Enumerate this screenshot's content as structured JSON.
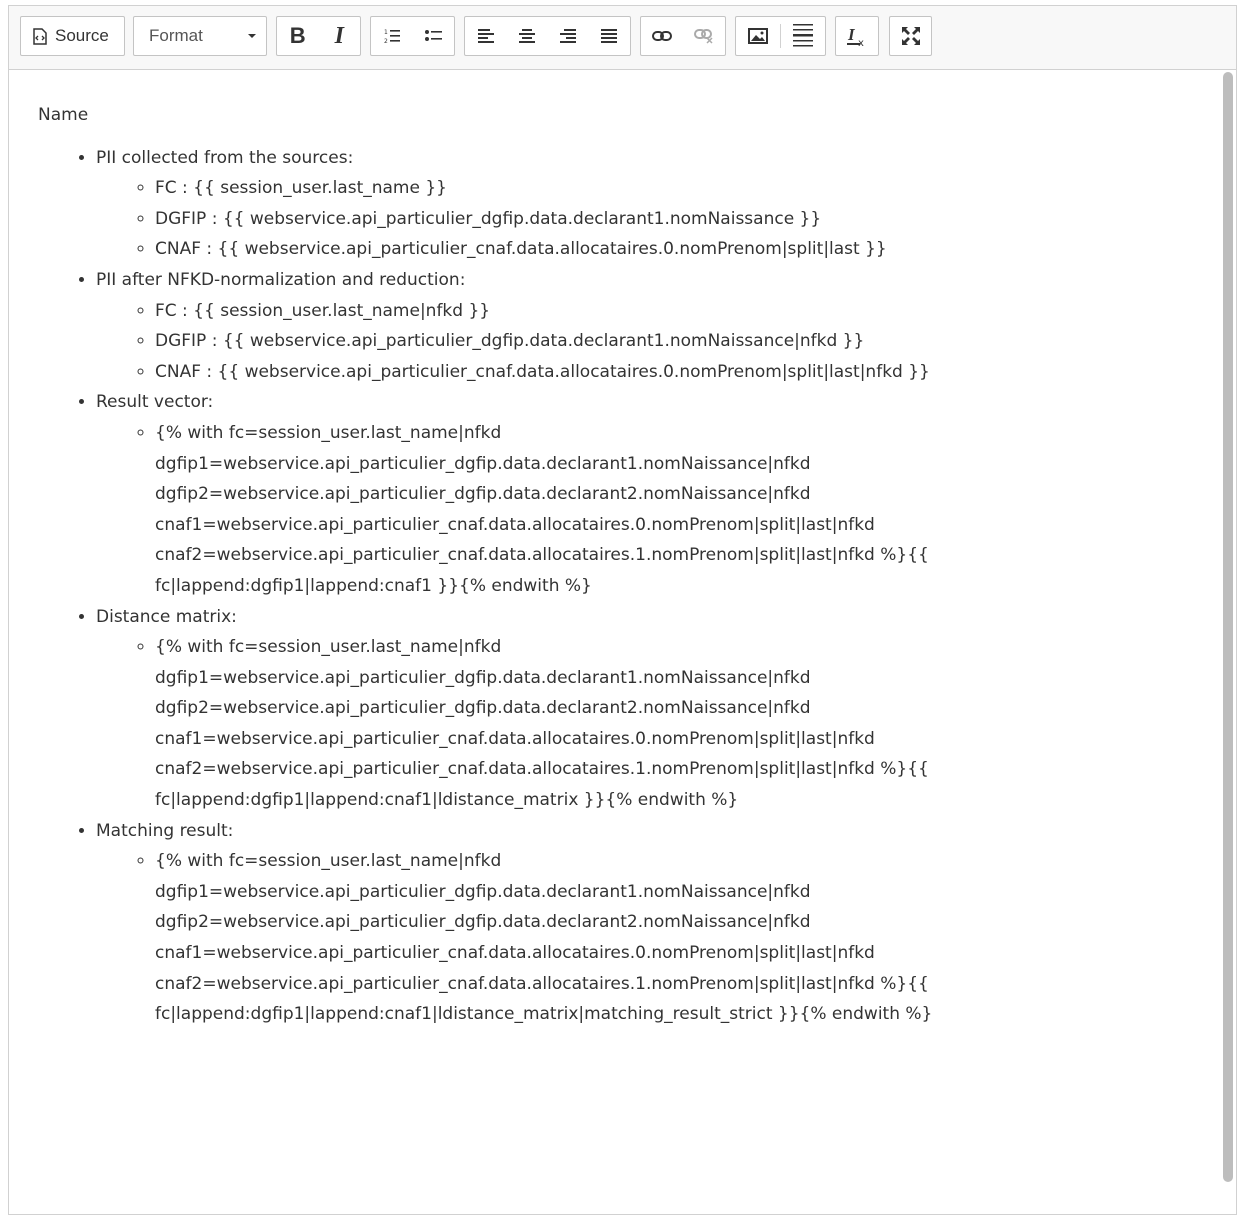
{
  "toolbar": {
    "source_label": "Source",
    "format_label": "Format",
    "bold_label": "B",
    "italic_label": "I",
    "icons": [
      "source-icon",
      "bold-icon",
      "italic-icon",
      "numbered-list-icon",
      "bulleted-list-icon",
      "align-left-icon",
      "align-center-icon",
      "align-right-icon",
      "align-justify-icon",
      "link-icon",
      "unlink-icon",
      "image-icon",
      "horizontal-rule-icon",
      "remove-format-icon",
      "maximize-icon"
    ]
  },
  "content": {
    "heading": "Name",
    "sections": [
      {
        "label": "PII collected from the sources:",
        "items": [
          "FC : {{ session_user.last_name }}",
          "DGFIP : {{ webservice.api_particulier_dgfip.data.declarant1.nomNaissance }}",
          "CNAF : {{ webservice.api_particulier_cnaf.data.allocataires.0.nomPrenom|split|last }}"
        ]
      },
      {
        "label": "PII after NFKD-normalization and reduction:",
        "items": [
          "FC : {{ session_user.last_name|nfkd }}",
          "DGFIP : {{ webservice.api_particulier_dgfip.data.declarant1.nomNaissance|nfkd }}",
          "CNAF : {{ webservice.api_particulier_cnaf.data.allocataires.0.nomPrenom|split|last|nfkd }}"
        ]
      },
      {
        "label": "Result vector:",
        "items": [
          "{% with fc=session_user.last_name|nfkd dgfip1=webservice.api_particulier_dgfip.data.declarant1.nomNaissance|nfkd dgfip2=webservice.api_particulier_dgfip.data.declarant2.nomNaissance|nfkd cnaf1=webservice.api_particulier_cnaf.data.allocataires.0.nomPrenom|split|last|nfkd cnaf2=webservice.api_particulier_cnaf.data.allocataires.1.nomPrenom|split|last|nfkd %}{{ fc|lappend:dgfip1|lappend:cnaf1 }}{% endwith %}"
        ]
      },
      {
        "label": "Distance matrix:",
        "items": [
          "{% with fc=session_user.last_name|nfkd dgfip1=webservice.api_particulier_dgfip.data.declarant1.nomNaissance|nfkd dgfip2=webservice.api_particulier_dgfip.data.declarant2.nomNaissance|nfkd cnaf1=webservice.api_particulier_cnaf.data.allocataires.0.nomPrenom|split|last|nfkd cnaf2=webservice.api_particulier_cnaf.data.allocataires.1.nomPrenom|split|last|nfkd %}{{ fc|lappend:dgfip1|lappend:cnaf1|ldistance_matrix }}{% endwith %}"
        ]
      },
      {
        "label": "Matching result:",
        "items": [
          "{% with fc=session_user.last_name|nfkd dgfip1=webservice.api_particulier_dgfip.data.declarant1.nomNaissance|nfkd dgfip2=webservice.api_particulier_dgfip.data.declarant2.nomNaissance|nfkd cnaf1=webservice.api_particulier_cnaf.data.allocataires.0.nomPrenom|split|last|nfkd cnaf2=webservice.api_particulier_cnaf.data.allocataires.1.nomPrenom|split|last|nfkd %}{{ fc|lappend:dgfip1|lappend:cnaf1|ldistance_matrix|matching_result_strict }}{% endwith %}"
        ]
      }
    ]
  }
}
